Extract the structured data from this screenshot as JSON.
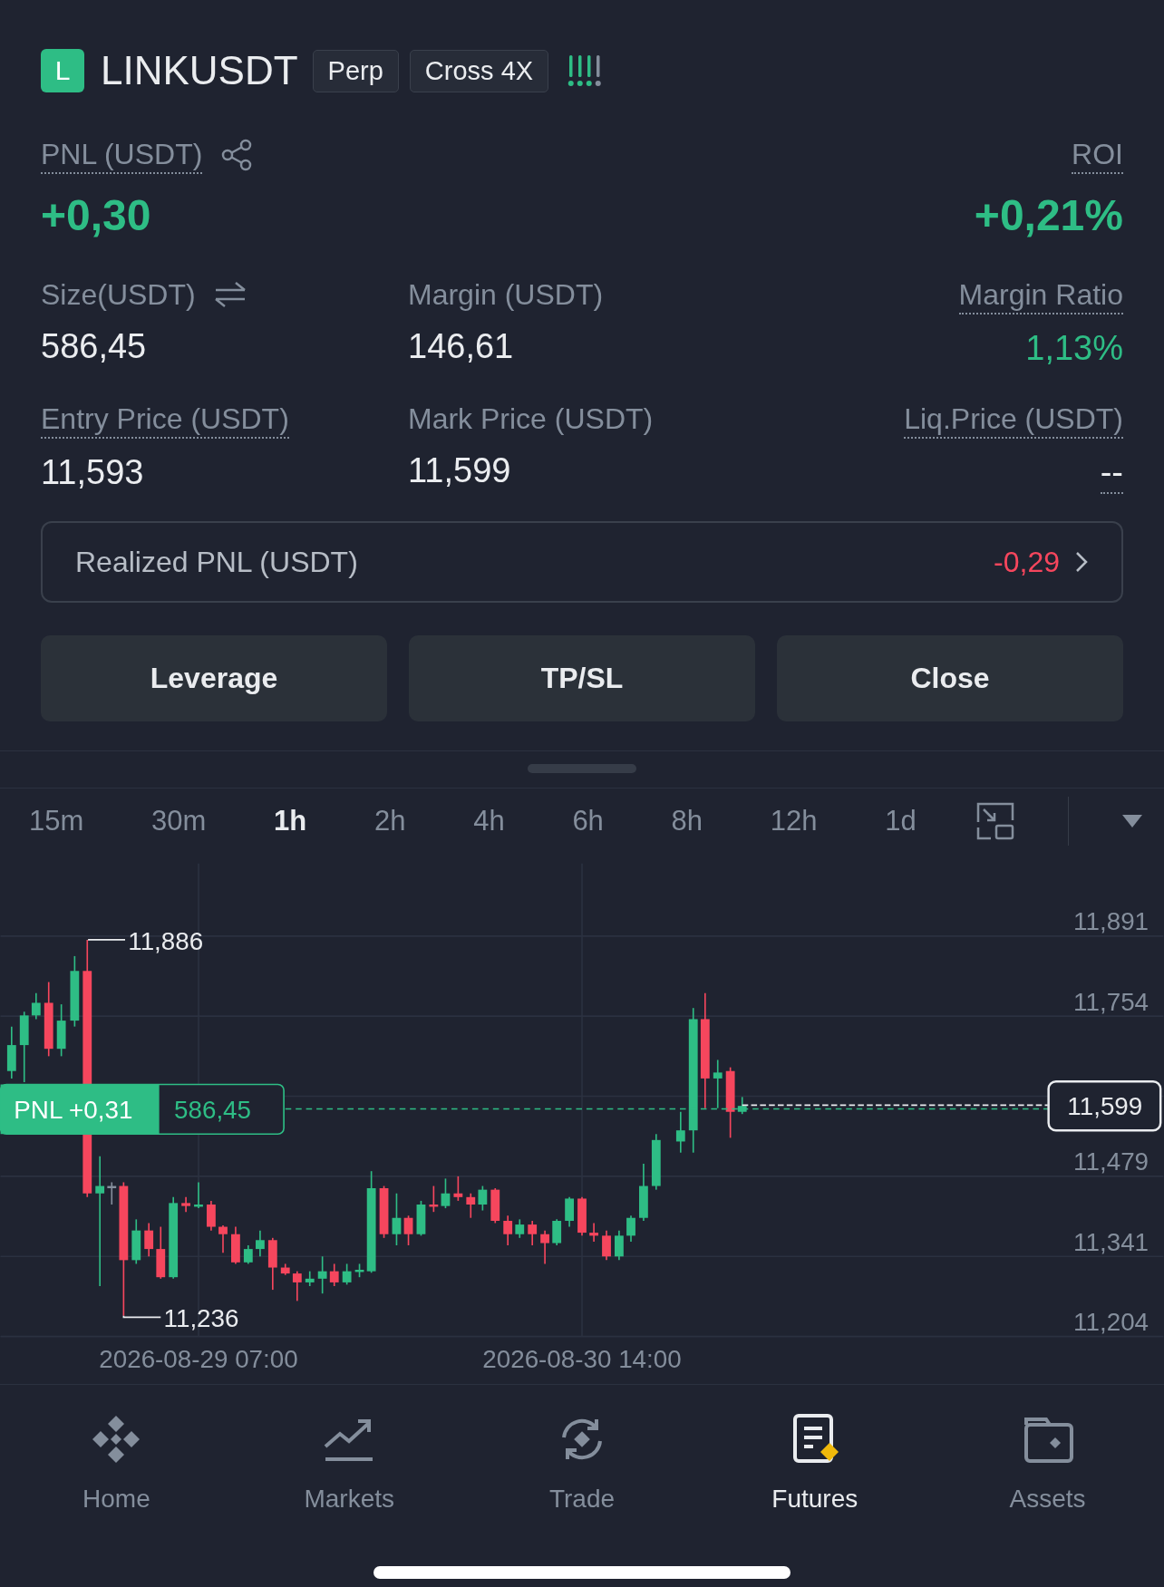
{
  "header": {
    "badge": "L",
    "symbol": "LINKUSDT",
    "tags": [
      "Perp",
      "Cross 4X"
    ]
  },
  "pnl": {
    "label": "PNL (USDT)",
    "value": "+0,30"
  },
  "roi": {
    "label": "ROI",
    "value": "+0,21%"
  },
  "stats": [
    {
      "label": "Size(USDT)",
      "value": "586,45",
      "dotted": false,
      "positive": false
    },
    {
      "label": "Margin (USDT)",
      "value": "146,61",
      "dotted": false,
      "positive": false
    },
    {
      "label": "Margin Ratio",
      "value": "1,13%",
      "dotted": true,
      "positive": true
    },
    {
      "label": "Entry Price (USDT)",
      "value": "11,593",
      "dotted": true,
      "positive": false
    },
    {
      "label": "Mark Price (USDT)",
      "value": "11,599",
      "dotted": false,
      "positive": false
    },
    {
      "label": "Liq.Price (USDT)",
      "value": "--",
      "dotted": true,
      "positive": false
    }
  ],
  "realized": {
    "label": "Realized PNL (USDT)",
    "value": "-0,29"
  },
  "buttons": [
    "Leverage",
    "TP/SL",
    "Close"
  ],
  "intervals": [
    {
      "label": "15m",
      "selected": false
    },
    {
      "label": "30m",
      "selected": false
    },
    {
      "label": "1h",
      "selected": true
    },
    {
      "label": "2h",
      "selected": false
    },
    {
      "label": "4h",
      "selected": false
    },
    {
      "label": "6h",
      "selected": false
    },
    {
      "label": "8h",
      "selected": false
    },
    {
      "label": "12h",
      "selected": false
    },
    {
      "label": "1d",
      "selected": false
    }
  ],
  "chart": {
    "price_labels": [
      "11,891",
      "11,754",
      "11,479",
      "11,341",
      "11,204"
    ],
    "high_label": "11,886",
    "low_label": "11,236",
    "position_pnl": "PNL +0,31",
    "position_size": "586,45",
    "last_price": "11,599",
    "time_labels": [
      "2026-08-29 07:00",
      "2026-08-30 14:00"
    ]
  },
  "nav": [
    {
      "label": "Home",
      "selected": false
    },
    {
      "label": "Markets",
      "selected": false
    },
    {
      "label": "Trade",
      "selected": false
    },
    {
      "label": "Futures",
      "selected": true
    },
    {
      "label": "Assets",
      "selected": false
    }
  ]
}
